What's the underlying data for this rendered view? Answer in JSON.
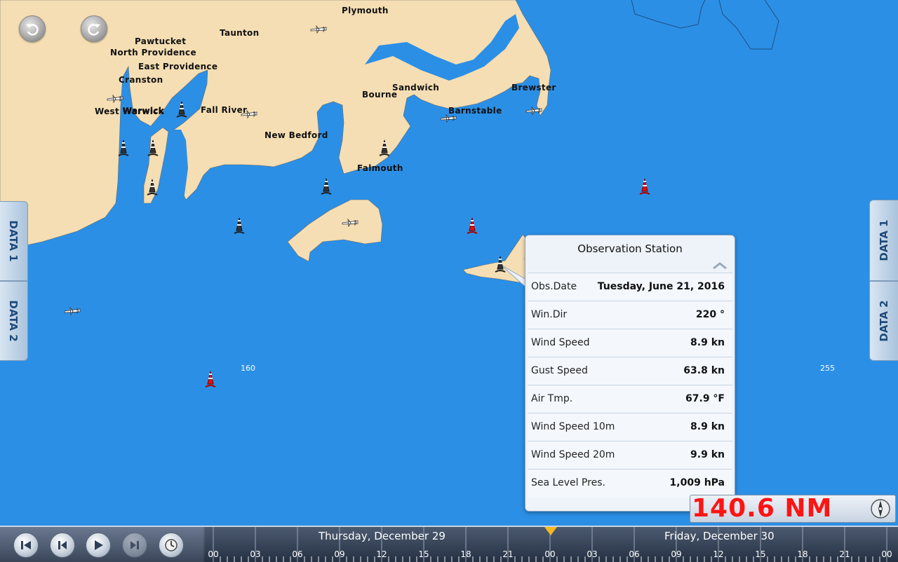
{
  "map": {
    "places": [
      "Plymouth",
      "Taunton",
      "Pawtucket",
      "North Providence",
      "East Providence",
      "Cranston",
      "West Warwick",
      "Warwick",
      "Fall River",
      "New Bedford",
      "Bourne",
      "Sandwich",
      "Barnstable",
      "Brewster",
      "Falmouth"
    ],
    "depths": [
      "160",
      "255"
    ],
    "colors": {
      "water": "#2b8fe6",
      "land": "#f5deb3",
      "buoy_red": "#e01010",
      "buoy_dark": "#333333"
    }
  },
  "nav": {
    "undo_icon": "undo-icon",
    "redo_icon": "redo-icon"
  },
  "side_tabs": {
    "left": [
      "DATA 1",
      "DATA 2"
    ],
    "right": [
      "DATA 1",
      "DATA 2"
    ]
  },
  "popup": {
    "title": "Observation Station",
    "rows": [
      {
        "label": "Obs.Date",
        "value": "Tuesday, June 21, 2016"
      },
      {
        "label": "Win.Dir",
        "value": "220 °"
      },
      {
        "label": "Wind Speed",
        "value": "8.9 kn"
      },
      {
        "label": "Gust Speed",
        "value": "63.8 kn"
      },
      {
        "label": "Air Tmp.",
        "value": "67.9 °F"
      },
      {
        "label": "Wind Speed 10m",
        "value": "8.9 kn"
      },
      {
        "label": "Wind Speed 20m",
        "value": "9.9 kn"
      },
      {
        "label": "Sea Level Pres.",
        "value": "1,009 hPa"
      }
    ]
  },
  "distance": {
    "value": "140.6 NM",
    "color": "#ff1414"
  },
  "timeline": {
    "days": [
      "Thursday, December 29",
      "Friday, December 30"
    ],
    "ticks": [
      "00",
      "03",
      "06",
      "09",
      "12",
      "15",
      "18",
      "21",
      "00",
      "03",
      "06",
      "09",
      "12",
      "15",
      "18",
      "21",
      "00"
    ],
    "cursor_color": "#f5b820"
  }
}
